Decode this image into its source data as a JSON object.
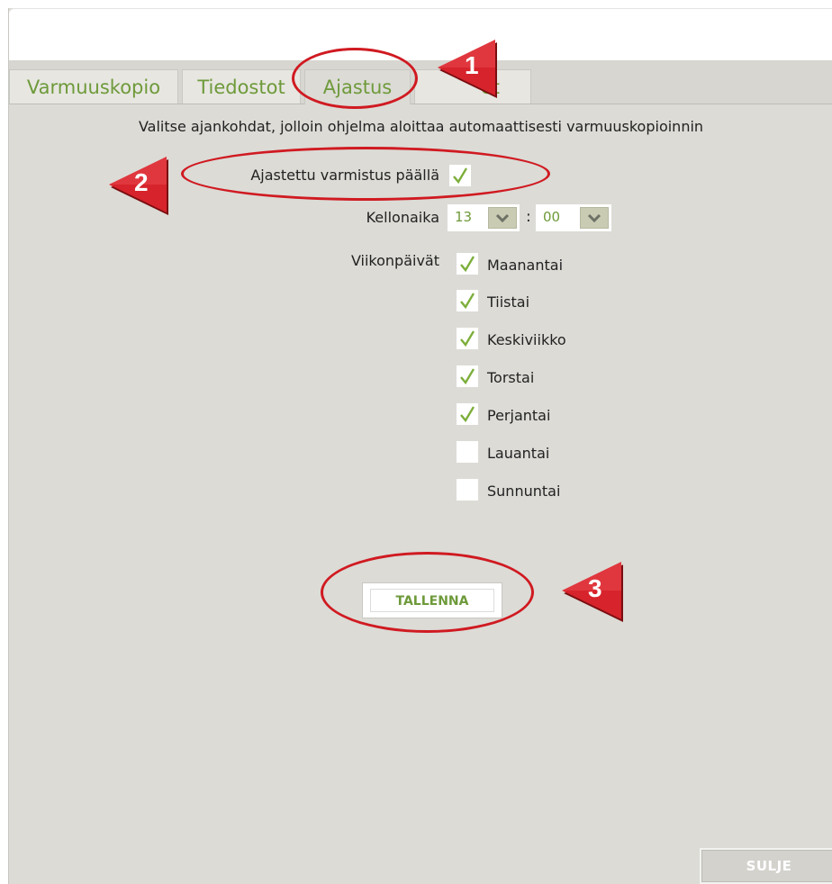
{
  "tabs": [
    {
      "label": "Varmuuskopio"
    },
    {
      "label": "Tiedostot"
    },
    {
      "label": "Ajastus"
    },
    {
      "label": "et"
    }
  ],
  "intro_text": "Valitse ajankohdat, jolloin ohjelma aloittaa automaattisesti varmuuskopioinnin",
  "schedule": {
    "enabled_label": "Ajastettu varmistus päällä",
    "enabled": true
  },
  "time": {
    "label": "Kellonaika",
    "hour": "13",
    "separator": ":",
    "minute": "00"
  },
  "weekdays": {
    "label": "Viikonpäivät",
    "days": [
      {
        "label": "Maanantai",
        "checked": true
      },
      {
        "label": "Tiistai",
        "checked": true
      },
      {
        "label": "Keskiviikko",
        "checked": true
      },
      {
        "label": "Torstai",
        "checked": true
      },
      {
        "label": "Perjantai",
        "checked": true
      },
      {
        "label": "Lauantai",
        "checked": false
      },
      {
        "label": "Sunnuntai",
        "checked": false
      }
    ]
  },
  "buttons": {
    "save": "TALLENNA",
    "close": "SULJE"
  },
  "annotations": {
    "marker1": "1",
    "marker2": "2",
    "marker3": "3"
  },
  "colors": {
    "accent_green": "#6e9a3a",
    "annotation_red": "#d01a21",
    "panel_bg": "#dcdbd6"
  }
}
